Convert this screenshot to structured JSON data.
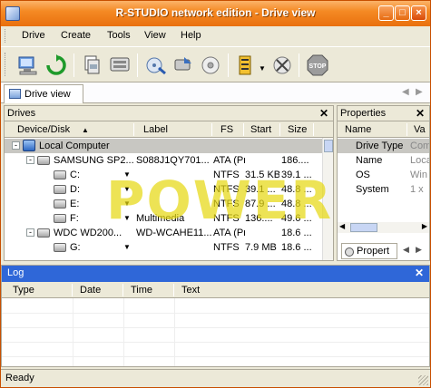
{
  "window": {
    "title": "R-STUDIO network edition - Drive view"
  },
  "menu": [
    "Drive",
    "Create",
    "Tools",
    "View",
    "Help"
  ],
  "toolbar": [
    {
      "icon": "connect-computer-icon"
    },
    {
      "icon": "refresh-icon"
    },
    {
      "icon": "open-images-icon"
    },
    {
      "icon": "region-icon"
    },
    {
      "icon": "scan-icon"
    },
    {
      "icon": "recover-icon"
    },
    {
      "icon": "disk-icon"
    },
    {
      "icon": "raid-icon"
    },
    {
      "icon": "remove-icon"
    },
    {
      "icon": "stop-icon",
      "label": "STOP"
    }
  ],
  "tab": {
    "label": "Drive view"
  },
  "drives": {
    "title": "Drives",
    "columns": [
      "Device/Disk",
      "Label",
      "FS",
      "Start",
      "Size"
    ],
    "rows": [
      {
        "level": 0,
        "type": "computer",
        "device": "Local Computer",
        "label": "",
        "fs": "",
        "start": "",
        "size": "",
        "selected": true,
        "expander": "-"
      },
      {
        "level": 1,
        "type": "disk",
        "device": "SAMSUNG SP2...",
        "label": "S088J1QY701...",
        "fs": "ATA (Primar...",
        "start": "",
        "size": "186....",
        "selected": false,
        "expander": "-"
      },
      {
        "level": 2,
        "type": "partition",
        "device": "C:",
        "label": "",
        "fs": "NTFS",
        "start": "31.5 KB",
        "size": "39.1 ...",
        "selected": false,
        "expander": ""
      },
      {
        "level": 2,
        "type": "partition",
        "device": "D:",
        "label": "",
        "fs": "NTFS",
        "start": "39.1 ...",
        "size": "48.8 ...",
        "selected": false,
        "expander": ""
      },
      {
        "level": 2,
        "type": "partition",
        "device": "E:",
        "label": "",
        "fs": "NTFS",
        "start": "87.9 ...",
        "size": "48.8 ...",
        "selected": false,
        "expander": ""
      },
      {
        "level": 2,
        "type": "partition",
        "device": "F:",
        "label": "Multimedia",
        "fs": "NTFS",
        "start": "136....",
        "size": "49.6 ...",
        "selected": false,
        "expander": ""
      },
      {
        "level": 1,
        "type": "disk",
        "device": "WDC WD200...",
        "label": "WD-WCAHE11...",
        "fs": "ATA (Primar...",
        "start": "",
        "size": "18.6 ...",
        "selected": false,
        "expander": "-"
      },
      {
        "level": 2,
        "type": "partition",
        "device": "G:",
        "label": "",
        "fs": "NTFS",
        "start": "7.9 MB",
        "size": "18.6 ...",
        "selected": false,
        "expander": ""
      }
    ]
  },
  "properties": {
    "title": "Properties",
    "columns": [
      "Name",
      "Va"
    ],
    "rows": [
      {
        "name": "Drive Type",
        "value": "Com",
        "selected": true
      },
      {
        "name": "Name",
        "value": "Loca",
        "selected": false
      },
      {
        "name": "OS",
        "value": "Win",
        "selected": false
      },
      {
        "name": "System",
        "value": "1 x",
        "selected": false
      }
    ],
    "tab_label": "Propert"
  },
  "log": {
    "title": "Log",
    "columns": [
      "Type",
      "Date",
      "Time",
      "Text"
    ]
  },
  "status": {
    "text": "Ready"
  },
  "watermark": {
    "text": "POWER"
  }
}
